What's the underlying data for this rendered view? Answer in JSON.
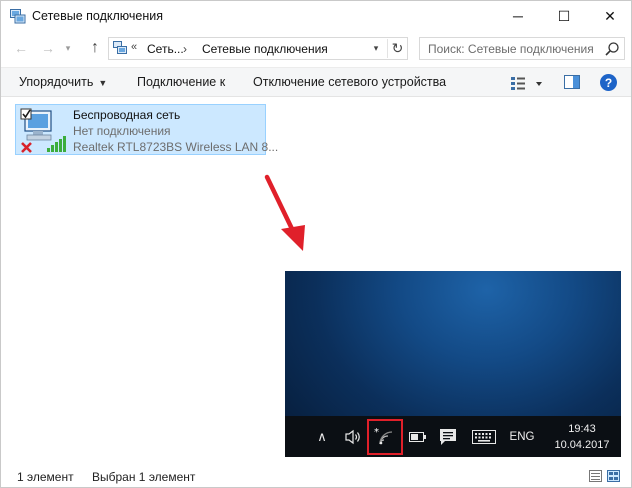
{
  "window": {
    "title": "Сетевые подключения",
    "controls": {
      "minimize": "─",
      "maximize": "☐",
      "close": "✕"
    }
  },
  "navigation": {
    "back": "←",
    "forward": "→",
    "up": "↑",
    "breadcrumb_chevron": "«",
    "breadcrumbs": [
      "Сеть...",
      "Сетевые подключения"
    ],
    "breadcrumb_separator": "›",
    "search_placeholder": "Поиск: Сетевые подключения"
  },
  "toolbar": {
    "organize_label": "Упорядочить",
    "connect_label": "Подключение к",
    "disconnect_label": "Отключение сетевого устройства",
    "help_label": "?"
  },
  "network_item": {
    "name": "Беспроводная сеть",
    "status": "Нет подключения",
    "adapter": "Realtek RTL8723BS Wireless LAN 8..."
  },
  "taskbar": {
    "language": "ENG",
    "time": "19:43",
    "date": "10.04.2017"
  },
  "statusbar": {
    "item_count": "1 элемент",
    "selected": "Выбран 1 элемент"
  },
  "colors": {
    "selection_fill": "#cce8ff",
    "selection_border": "#99d1ff",
    "annotation_red": "#e0202a",
    "help_blue": "#1e64c8",
    "taskbar": "#0b0f14"
  }
}
